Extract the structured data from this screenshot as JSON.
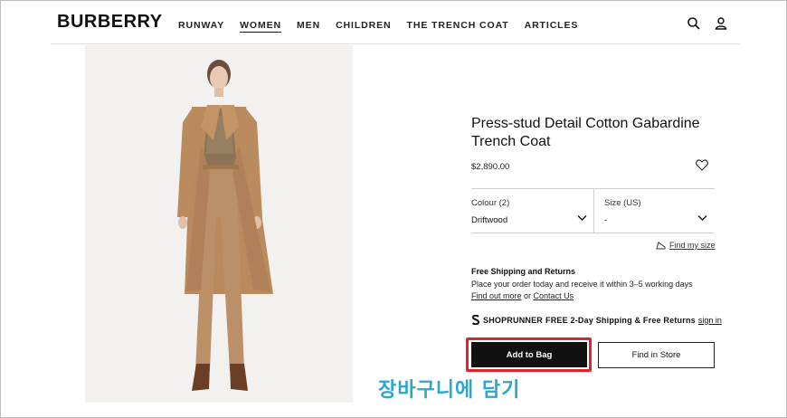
{
  "brand": "BURBERRY",
  "nav": {
    "items": [
      {
        "label": "RUNWAY",
        "active": false
      },
      {
        "label": "WOMEN",
        "active": true
      },
      {
        "label": "MEN",
        "active": false
      },
      {
        "label": "CHILDREN",
        "active": false
      },
      {
        "label": "THE TRENCH COAT",
        "active": false
      },
      {
        "label": "ARTICLES",
        "active": false
      }
    ],
    "icons": [
      "search-icon",
      "account-icon"
    ]
  },
  "product": {
    "title": "Press-stud Detail Cotton Gabardine Trench Coat",
    "price": "$2,890.00",
    "image_alt": "product-photo",
    "colour": {
      "label": "Colour (2)",
      "value": "Driftwood"
    },
    "size": {
      "label": "Size (US)",
      "value": "-"
    },
    "find_size": "Find my size"
  },
  "shipping": {
    "title": "Free Shipping and Returns",
    "text": "Place your order today and receive it within 3–5 working days",
    "link1": "Find out more",
    "or": " or ",
    "link2": "Contact Us"
  },
  "shoprunner": {
    "brand": "SHOPRUNNER",
    "text": "FREE 2-Day Shipping & Free Returns",
    "link": "sign in"
  },
  "buttons": {
    "add_to_bag": "Add to Bag",
    "find_in_store": "Find in Store"
  },
  "annotation": {
    "text": "장바구니에 담기",
    "color": "#2aa7c9",
    "highlight_color": "#e0242b"
  }
}
